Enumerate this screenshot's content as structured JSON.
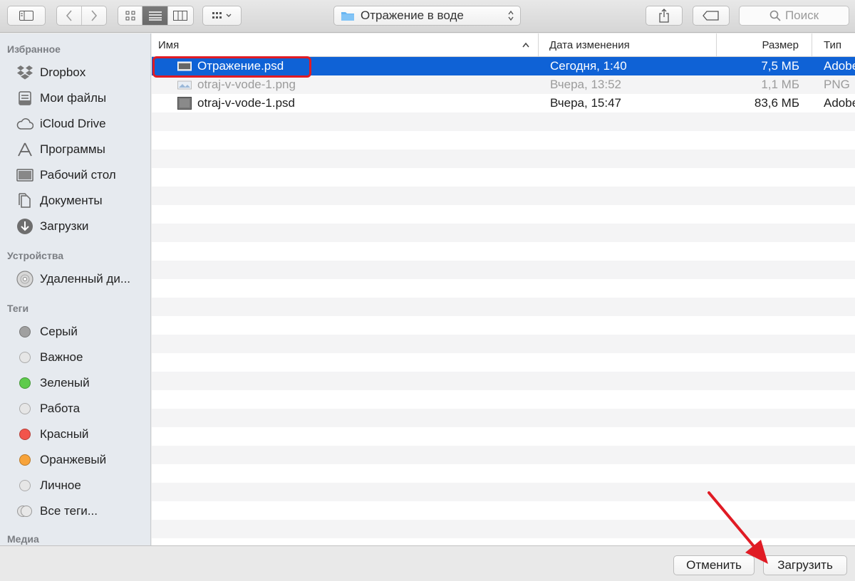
{
  "toolbar": {
    "path_label": "Отражение в воде",
    "search_placeholder": "Поиск"
  },
  "sidebar": {
    "favorites_title": "Избранное",
    "favorites": [
      {
        "label": "Dropbox",
        "icon": "dropbox-icon"
      },
      {
        "label": "Мои файлы",
        "icon": "all-files-icon"
      },
      {
        "label": "iCloud Drive",
        "icon": "cloud-icon"
      },
      {
        "label": "Программы",
        "icon": "applications-icon"
      },
      {
        "label": "Рабочий стол",
        "icon": "desktop-icon"
      },
      {
        "label": "Документы",
        "icon": "documents-icon"
      },
      {
        "label": "Загрузки",
        "icon": "downloads-icon"
      }
    ],
    "devices_title": "Устройства",
    "devices": [
      {
        "label": "Удаленный ди...",
        "icon": "disc-icon"
      }
    ],
    "tags_title": "Теги",
    "tags": [
      {
        "label": "Серый",
        "color": "#a0a0a0"
      },
      {
        "label": "Важное",
        "color": "#e0e0e0"
      },
      {
        "label": "Зеленый",
        "color": "#5ecb4c"
      },
      {
        "label": "Работа",
        "color": "#e0e0e0"
      },
      {
        "label": "Красный",
        "color": "#f2544b"
      },
      {
        "label": "Оранжевый",
        "color": "#f7a33a"
      },
      {
        "label": "Личное",
        "color": "#e0e0e0"
      },
      {
        "label": "Все теги...",
        "color": "#dcdcdc"
      }
    ],
    "media_title": "Медиа"
  },
  "table": {
    "headers": {
      "name": "Имя",
      "date": "Дата изменения",
      "size": "Размер",
      "type": "Тип"
    },
    "rows": [
      {
        "name": "Отражение.psd",
        "date": "Сегодня, 1:40",
        "size": "7,5 МБ",
        "type": "Adobe",
        "state": "selected"
      },
      {
        "name": "otraj-v-vode-1.png",
        "date": "Вчера, 13:52",
        "size": "1,1 МБ",
        "type": "PNG",
        "state": "dim"
      },
      {
        "name": "otraj-v-vode-1.psd",
        "date": "Вчера, 15:47",
        "size": "83,6 МБ",
        "type": "Adobe",
        "state": "normal"
      }
    ]
  },
  "buttons": {
    "cancel": "Отменить",
    "upload": "Загрузить"
  },
  "colors": {
    "selection": "#0f62d6",
    "annotation": "#e01b24"
  }
}
